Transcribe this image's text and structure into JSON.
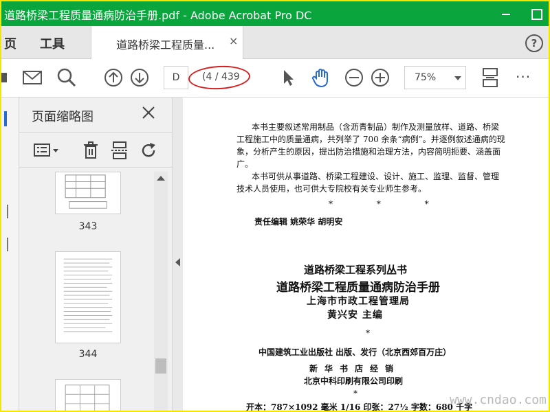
{
  "window": {
    "title": "道路桥梁工程质量通病防治手册.pdf - Adobe Acrobat Pro DC"
  },
  "menu": {
    "home": "页",
    "tools": "工具"
  },
  "document_tab": {
    "label": "道路桥梁工程质量...",
    "close": "×"
  },
  "help": "?",
  "toolbar": {
    "page_input": "D",
    "page_count": "(4 / 439",
    "zoom": "75%",
    "more": "···",
    "icons": [
      "mail-icon",
      "search-icon",
      "prev-page-icon",
      "next-page-icon",
      "select-cursor-icon",
      "hand-tool-icon",
      "zoom-out-icon",
      "zoom-in-icon",
      "fit-page-icon"
    ]
  },
  "thumbnails_panel": {
    "title": "页面缩略图",
    "close": "×",
    "tools": [
      "page-options-icon",
      "delete-icon",
      "crop-icon",
      "rotate-icon"
    ],
    "items": [
      {
        "label": "343"
      },
      {
        "label": "344"
      }
    ]
  },
  "page": {
    "para1_line1": "本书主要叙述常用制品（含沥青制品）制作及测量放样、道路、桥梁",
    "para1_line2": "工程施工中的质量通病，共列举了 700 余条“病例”。并逐例叙述通病的现",
    "para1_line3": "象，分析产生的原因，提出防治措施和治理方法，内容简明扼要、涵盖面",
    "para1_line4": "广。",
    "para2_line1": "本书可供从事道路、桥梁工程建设、设计、施工、监理、监督、管理",
    "para2_line2": "技术人员使用，也可供大专院校有关专业师生参考。",
    "stars": "* * *",
    "editors": "责任编辑  姚荣华  胡明安",
    "series": "道路桥梁工程系列丛书",
    "book_title": "道路桥梁工程质量通病防治手册",
    "organization": "上海市市政工程管理局",
    "author": "黄兴安  主编",
    "star_single": "*",
    "publisher": "中国建筑工业出版社 出版、发行（北京西郊百万庄）",
    "seller": "新华书店经销",
    "printer": "北京中科印刷有限公司印刷",
    "star_single2": "*",
    "format": "开本：787×1092 毫米  1/16   印张：27½ 字数：680 千字"
  },
  "watermark": "www.cndao.com",
  "colors": {
    "title_bar": "#0aa53d",
    "frame": "#ffff00",
    "annotation_ellipse": "#d42020",
    "accent_blue": "#2a6ad3"
  }
}
